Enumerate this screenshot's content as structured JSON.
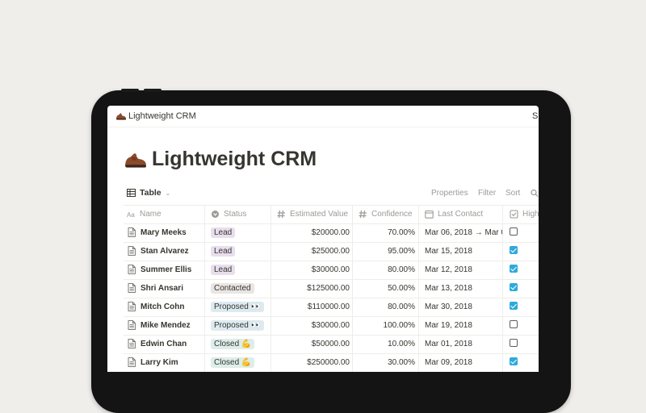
{
  "breadcrumb": {
    "title": "Lightweight CRM",
    "share": "Sh"
  },
  "page": {
    "title": "Lightweight CRM",
    "icon": "shoe-icon"
  },
  "toolbar": {
    "view_name": "Table",
    "properties": "Properties",
    "filter": "Filter",
    "sort": "Sort"
  },
  "columns": {
    "name": "Name",
    "status": "Status",
    "value": "Estimated Value",
    "confidence": "Confidence",
    "last_contact": "Last Contact",
    "high": "High"
  },
  "colors": {
    "lead": "#e8deee",
    "contacted": "#e9e5e3",
    "proposed": "#ddebf1",
    "closed": "#ddedea",
    "checkbox_checked": "#2eaadc"
  },
  "rows": [
    {
      "name": "Mary Meeks",
      "status": "Lead",
      "status_kind": "lead",
      "value": "$20000.00",
      "confidence": "70.00%",
      "last_contact": "Mar 06, 2018 → Mar 0",
      "high": false
    },
    {
      "name": "Stan Alvarez",
      "status": "Lead",
      "status_kind": "lead",
      "value": "$25000.00",
      "confidence": "95.00%",
      "last_contact": "Mar 15, 2018",
      "high": true
    },
    {
      "name": "Summer Ellis",
      "status": "Lead",
      "status_kind": "lead",
      "value": "$30000.00",
      "confidence": "80.00%",
      "last_contact": "Mar 12, 2018",
      "high": true
    },
    {
      "name": "Shri Ansari",
      "status": "Contacted",
      "status_kind": "contacted",
      "value": "$125000.00",
      "confidence": "50.00%",
      "last_contact": "Mar 13, 2018",
      "high": true
    },
    {
      "name": "Mitch Cohn",
      "status": "Proposed 👀",
      "status_kind": "proposed",
      "value": "$110000.00",
      "confidence": "80.00%",
      "last_contact": "Mar 30, 2018",
      "high": true
    },
    {
      "name": "Mike Mendez",
      "status": "Proposed 👀",
      "status_kind": "proposed",
      "value": "$30000.00",
      "confidence": "100.00%",
      "last_contact": "Mar 19, 2018",
      "high": false
    },
    {
      "name": "Edwin Chan",
      "status": "Closed 💪",
      "status_kind": "closed",
      "value": "$50000.00",
      "confidence": "10.00%",
      "last_contact": "Mar 01, 2018",
      "high": false
    },
    {
      "name": "Larry Kim",
      "status": "Closed 💪",
      "status_kind": "closed",
      "value": "$250000.00",
      "confidence": "30.00%",
      "last_contact": "Mar 09, 2018",
      "high": true
    }
  ]
}
